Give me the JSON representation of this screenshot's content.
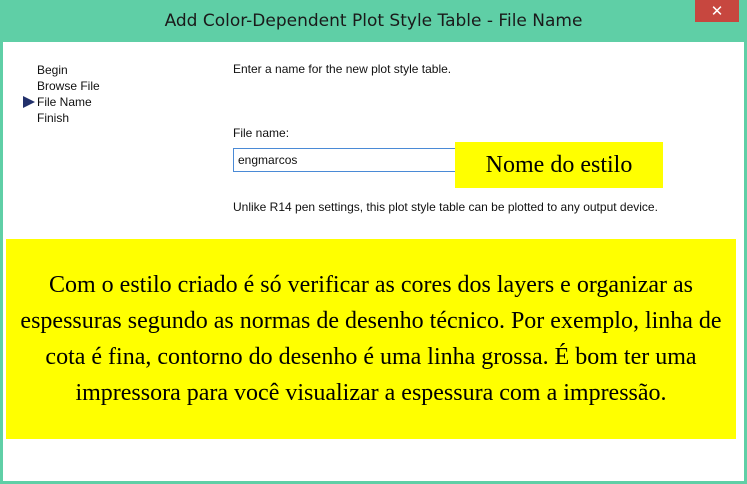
{
  "window": {
    "title": "Add Color-Dependent Plot Style Table - File Name",
    "close_glyph": "✕"
  },
  "steps": [
    {
      "label": "Begin",
      "current": false
    },
    {
      "label": "Browse File",
      "current": false
    },
    {
      "label": "File Name",
      "current": true
    },
    {
      "label": "Finish",
      "current": false
    }
  ],
  "content": {
    "intro": "Enter a name for the new plot style table.",
    "file_label": "File name:",
    "file_value": "engmarcos",
    "hint": "Unlike R14 pen settings, this plot style table can be plotted to any output device."
  },
  "annotations": {
    "small": "Nome do estilo",
    "big": "Com o estilo criado é só verificar as cores dos layers e organizar as espessuras segundo as normas de desenho técnico. Por exemplo, linha de cota é fina, contorno do desenho é uma linha grossa. É bom ter uma impressora para você visualizar a espessura com a impressão."
  },
  "colors": {
    "titlebar": "#5fcfa6",
    "close_button": "#c7473f",
    "highlight": "#ffff00",
    "current_step_arrow": "#22306b",
    "input_border": "#4a8ad6"
  }
}
